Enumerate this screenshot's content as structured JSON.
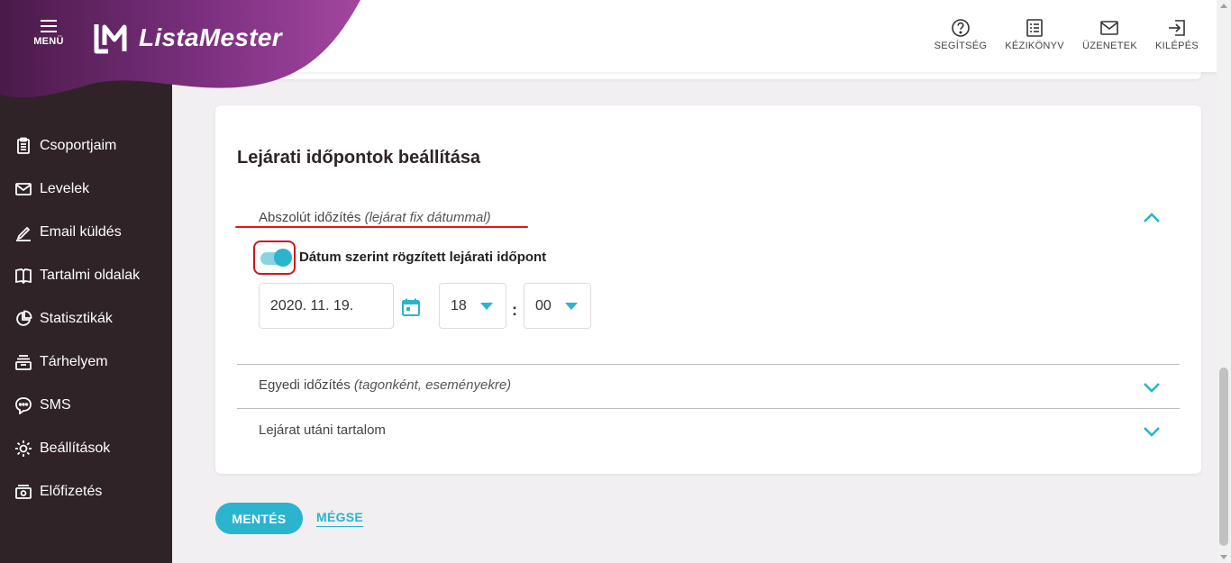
{
  "header": {
    "menu_label": "MENÜ",
    "brand_name": "ListaMester",
    "tools": [
      {
        "label": "SEGÍTSÉG",
        "icon": "help-icon"
      },
      {
        "label": "KÉZIKÖNYV",
        "icon": "manual-icon"
      },
      {
        "label": "ÜZENETEK",
        "icon": "mail-icon"
      },
      {
        "label": "KILÉPÉS",
        "icon": "logout-icon"
      }
    ]
  },
  "sidebar": {
    "items": [
      {
        "label": "Csoportjaim",
        "icon": "clipboard-icon"
      },
      {
        "label": "Levelek",
        "icon": "envelope-icon"
      },
      {
        "label": "Email küldés",
        "icon": "pencil-icon"
      },
      {
        "label": "Tartalmi oldalak",
        "icon": "book-icon"
      },
      {
        "label": "Statisztikák",
        "icon": "pie-chart-icon"
      },
      {
        "label": "Tárhelyem",
        "icon": "storage-icon"
      },
      {
        "label": "SMS",
        "icon": "chat-bubble-icon"
      },
      {
        "label": "Beállítások",
        "icon": "gear-icon"
      },
      {
        "label": "Előfizetés",
        "icon": "billing-icon"
      }
    ]
  },
  "main": {
    "section_title": "Lejárati időpontok beállítása",
    "accordions": [
      {
        "title": "Abszolút időzítés",
        "subtitle": "(lejárat fix dátummal)",
        "expanded": true
      },
      {
        "title": "Egyedi időzítés",
        "subtitle": "(tagonként, eseményekre)",
        "expanded": false
      },
      {
        "title": "Lejárat utáni tartalom",
        "subtitle": "",
        "expanded": false
      }
    ],
    "toggle": {
      "label": "Dátum szerint rögzített lejárati időpont",
      "on": true
    },
    "date_value": "2020. 11. 19.",
    "hour_value": "18",
    "minute_value": "00",
    "time_separator": ":"
  },
  "actions": {
    "save_label": "MENTÉS",
    "cancel_label": "MÉGSE"
  },
  "colors": {
    "accent": "#2ab4cd",
    "sidebar_bg": "#2f2328",
    "brand_purple": "#7a2f7e",
    "highlight_red": "#e3151a"
  }
}
